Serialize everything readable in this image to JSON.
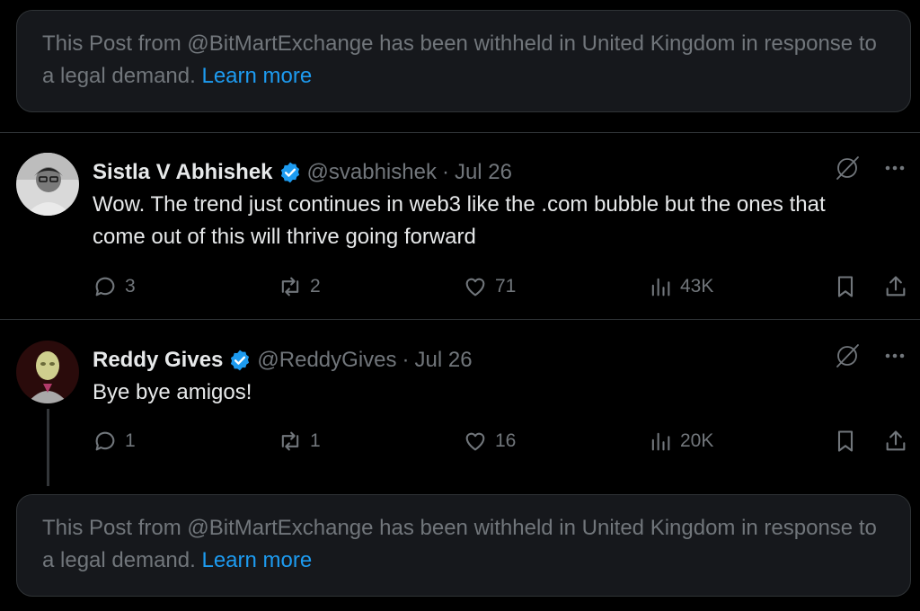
{
  "notices": [
    {
      "text": "This Post from @BitMartExchange has been withheld in United Kingdom in response to a legal demand.",
      "link": "Learn more"
    },
    {
      "text": "This Post from @BitMartExchange has been withheld in United Kingdom in response to a legal demand.",
      "link": "Learn more"
    }
  ],
  "posts": [
    {
      "name": "Sistla V Abhishek",
      "handle": "@svabhishek",
      "separator": "·",
      "date": "Jul 26",
      "text": "Wow. The trend just continues in web3 like the .com bubble but the ones that come out of this will thrive going forward",
      "replies": "3",
      "reposts": "2",
      "likes": "71",
      "views": "43K"
    },
    {
      "name": "Reddy Gives",
      "handle": "@ReddyGives",
      "separator": "·",
      "date": "Jul 26",
      "text": "Bye bye amigos!",
      "replies": "1",
      "reposts": "1",
      "likes": "16",
      "views": "20K"
    }
  ],
  "colors": {
    "background": "#000000",
    "text": "#e7e9ea",
    "muted": "#71767b",
    "link": "#1d9bf0",
    "verified": "#1d9bf0"
  },
  "icons": [
    "verified-badge-icon",
    "grok-icon",
    "more-icon",
    "reply-icon",
    "repost-icon",
    "like-icon",
    "views-icon",
    "bookmark-icon",
    "share-icon"
  ]
}
